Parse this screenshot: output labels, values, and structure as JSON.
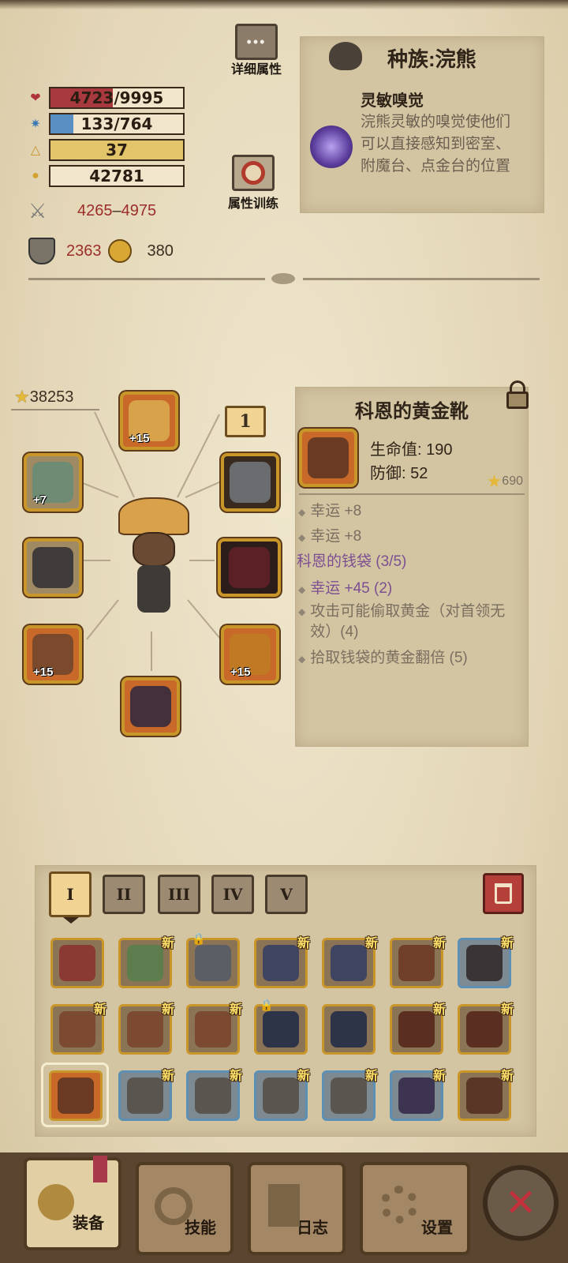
{
  "stats": {
    "hp": {
      "text": "4723/9995",
      "fraction": 0.4725,
      "color": "#a8393f"
    },
    "mp": {
      "text": "133/764",
      "fraction": 0.174,
      "color": "#5a8fc4"
    },
    "level": {
      "text": "37",
      "fraction": 1.0,
      "color": "#e2c56a"
    },
    "gold": {
      "text": "42781",
      "fraction": 0,
      "color": "#f1e6cb"
    },
    "attack": {
      "min": "4265",
      "sep": "–",
      "max": "4975"
    },
    "defense": "2363",
    "luck": "380"
  },
  "buttons": {
    "details_label": "详细属性",
    "training_label": "属性训练"
  },
  "race": {
    "title": "种族:浣熊",
    "trait_name": "灵敏嗅觉",
    "trait_desc": "浣熊灵敏的嗅觉使他们可以直接感知到密室、附魔台、点金台的位置"
  },
  "character": {
    "score": "38253",
    "set_count": "1",
    "slots": {
      "head_plus": "+15",
      "neck_plus": "+7",
      "ring_plus": "+15",
      "belt_plus": "+15"
    }
  },
  "item": {
    "name": "科恩的黄金靴",
    "stat1": "生命值: 190",
    "stat2": "防御: 52",
    "score": "690",
    "affix1": "幸运 +8",
    "affix2": "幸运 +8",
    "set_name": "科恩的钱袋 (3/5)",
    "set_bonus1": "幸运 +45 (2)",
    "set_bonus2": "攻击可能偷取黄金（对首领无效）(4)",
    "set_bonus3": "拾取钱袋的黄金翻倍 (5)"
  },
  "inventory": {
    "tabs": [
      "I",
      "II",
      "III",
      "IV",
      "V"
    ],
    "new_label": "新"
  },
  "nav": {
    "equip": "装备",
    "skills": "技能",
    "log": "日志",
    "settings": "设置",
    "close": "✕"
  }
}
